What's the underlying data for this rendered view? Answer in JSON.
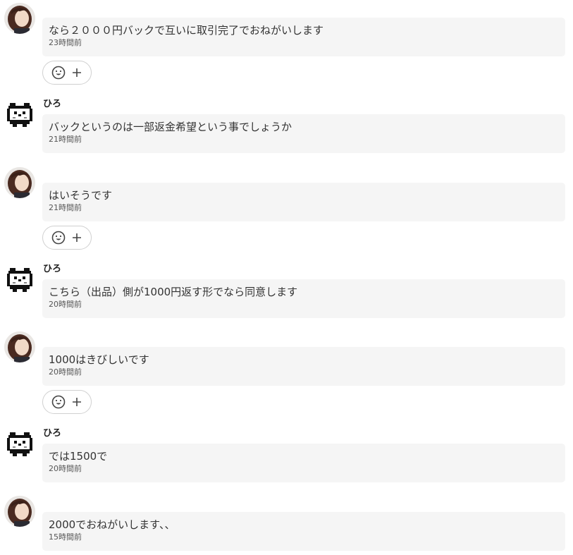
{
  "messages": [
    {
      "sender": "",
      "side": "buyer",
      "text": "なら２０００円バックで互いに取引完了でおねがいします",
      "time": "23時間前",
      "has_reaction": true
    },
    {
      "sender": "ひろ",
      "side": "seller",
      "text": "バックというのは一部返金希望という事でしょうか",
      "time": "21時間前",
      "has_reaction": false
    },
    {
      "sender": "",
      "side": "buyer",
      "text": "はいそうです",
      "time": "21時間前",
      "has_reaction": true
    },
    {
      "sender": "ひろ",
      "side": "seller",
      "text": "こちら（出品）側が1000円返す形でなら同意します",
      "time": "20時間前",
      "has_reaction": false
    },
    {
      "sender": "",
      "side": "buyer",
      "text": "1000はきびしいです",
      "time": "20時間前",
      "has_reaction": true
    },
    {
      "sender": "ひろ",
      "side": "seller",
      "text": "では1500で",
      "time": "20時間前",
      "has_reaction": false
    },
    {
      "sender": "",
      "side": "buyer",
      "text": "2000でおねがいします、、",
      "time": "15時間前",
      "has_reaction": false
    }
  ],
  "icons": {
    "reaction_emoji": "smiley-face-icon",
    "reaction_add": "plus-icon",
    "buyer_avatar": "user-photo-avatar",
    "seller_avatar": "pixel-character-avatar"
  },
  "colors": {
    "bubble_bg": "#f5f5f5",
    "text": "#333333",
    "reaction_border": "#d0d0d0"
  }
}
